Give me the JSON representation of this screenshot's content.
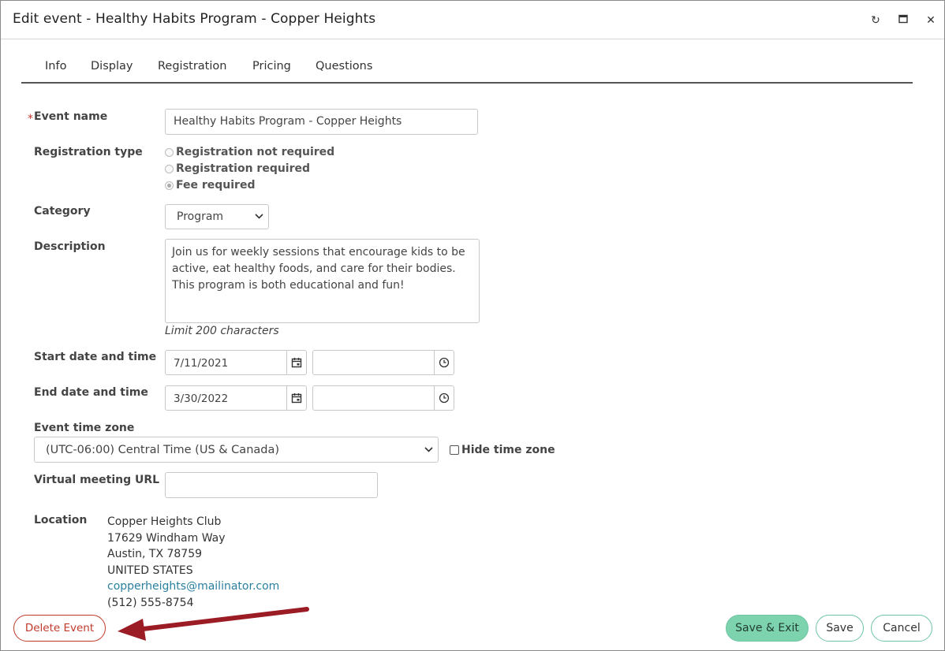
{
  "dialog": {
    "title": "Edit event - Healthy Habits Program - Copper Heights",
    "controls": {
      "refresh": "↻",
      "maximize": "▭",
      "close": "✕"
    }
  },
  "tabs": [
    {
      "label": "Info"
    },
    {
      "label": "Display"
    },
    {
      "label": "Registration"
    },
    {
      "label": "Pricing"
    },
    {
      "label": "Questions"
    }
  ],
  "form": {
    "required_marker": "*",
    "event_name": {
      "label": "Event name",
      "value": "Healthy Habits Program - Copper Heights"
    },
    "registration_type": {
      "label": "Registration type",
      "options": [
        {
          "label": "Registration not required",
          "selected": false
        },
        {
          "label": "Registration required",
          "selected": false
        },
        {
          "label": "Fee required",
          "selected": true
        }
      ]
    },
    "category": {
      "label": "Category",
      "value": "Program"
    },
    "description": {
      "label": "Description",
      "value": "Join us for weekly sessions that encourage kids to be active, eat healthy foods, and care for their bodies. This program is both educational and fun!",
      "hint": "Limit 200 characters"
    },
    "start": {
      "label": "Start date and time",
      "date": "7/11/2021",
      "time": ""
    },
    "end": {
      "label": "End date and time",
      "date": "3/30/2022",
      "time": ""
    },
    "timezone": {
      "label": "Event time zone",
      "value": "(UTC-06:00) Central Time (US & Canada)",
      "hide_label": "Hide time zone",
      "hide_checked": false
    },
    "virtual_url": {
      "label": "Virtual meeting URL",
      "value": ""
    },
    "location": {
      "label": "Location",
      "name": "Copper Heights Club",
      "street": "17629 Windham Way",
      "city": "Austin, TX 78759",
      "country": "UNITED STATES",
      "email": "copperheights@mailinator.com",
      "phone": "(512) 555-8754"
    }
  },
  "buttons": {
    "delete": "Delete Event",
    "save_exit": "Save & Exit",
    "save": "Save",
    "cancel": "Cancel"
  },
  "colors": {
    "danger": "#c0392b",
    "accent_green": "#7dd3ae",
    "link": "#2a7f9e",
    "annotation_arrow": "#9b1c24"
  }
}
